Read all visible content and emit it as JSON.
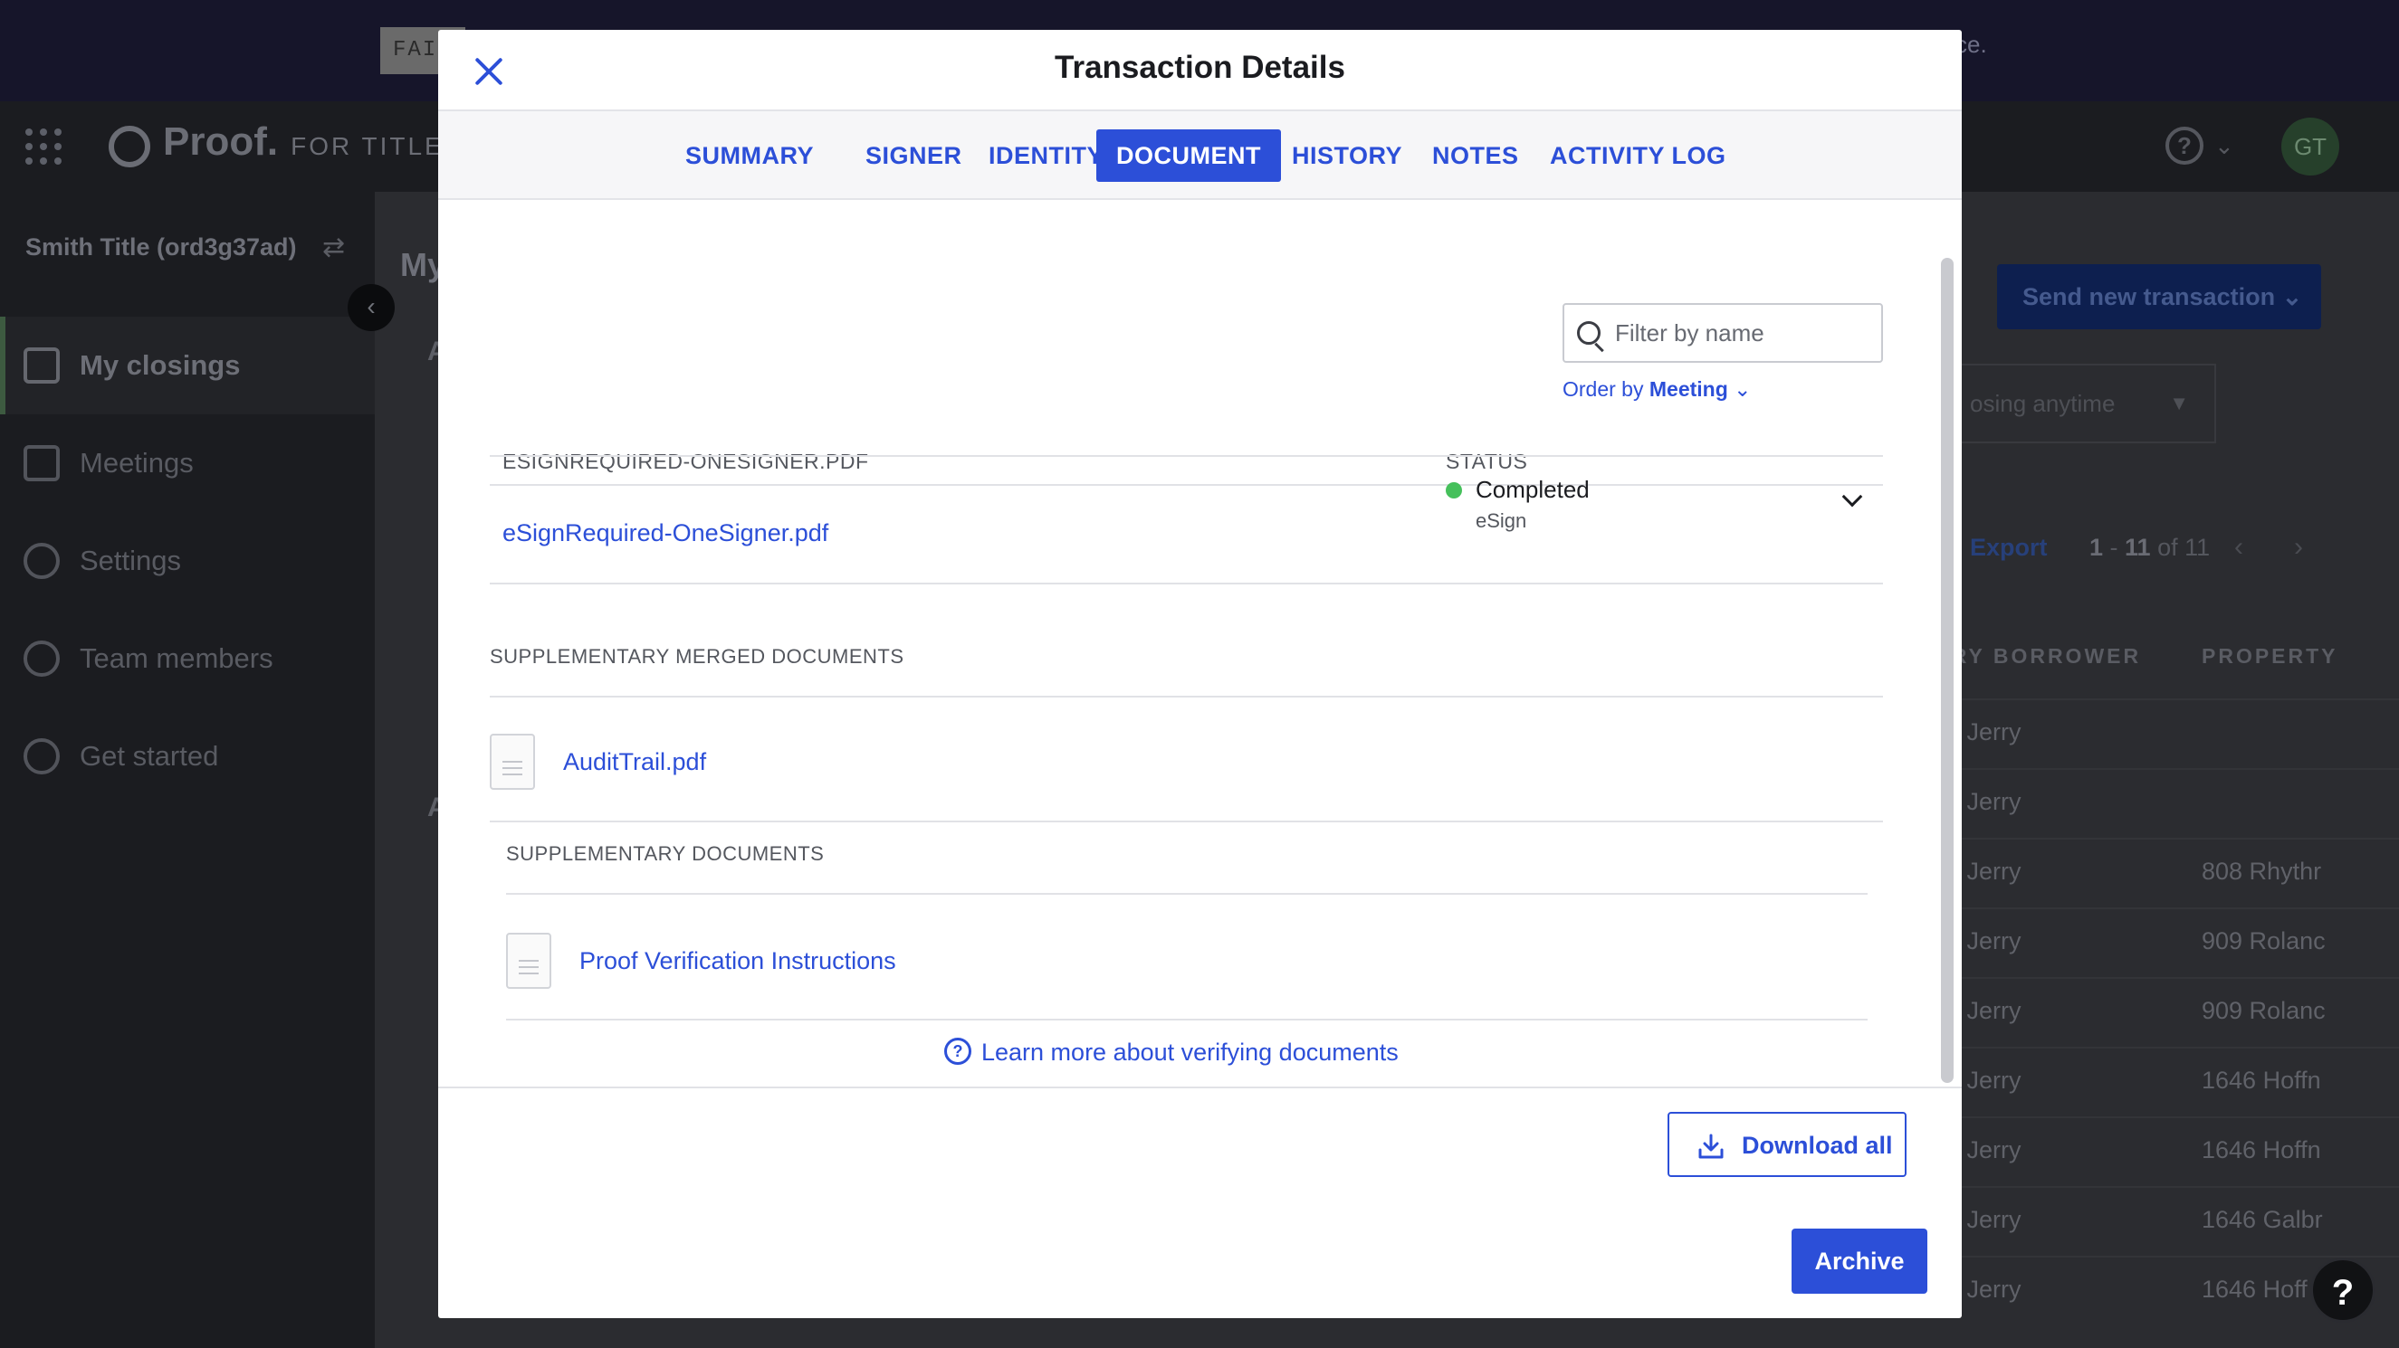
{
  "banner": {
    "tag": "FAIL",
    "tail": "ce."
  },
  "topnav": {
    "logo_word": "Proof.",
    "logo_sub": "FOR TITLE",
    "avatar_initials": "GT"
  },
  "sidebar": {
    "org": "Smith Title (ord3g37ad)",
    "items": [
      {
        "label": "My closings",
        "icon": "grid-icon",
        "active": true
      },
      {
        "label": "Meetings",
        "icon": "calendar-icon"
      },
      {
        "label": "Settings",
        "icon": "gear-icon"
      },
      {
        "label": "Team members",
        "icon": "users-icon"
      },
      {
        "label": "Get started",
        "icon": "rocket-icon"
      }
    ]
  },
  "main": {
    "title": "My",
    "letter_a": "A",
    "send_button": "Send new transaction",
    "closing_filter": "osing anytime",
    "export": "Export",
    "paging": {
      "start": "1",
      "dash": " - ",
      "end": "11",
      "of": " of 11"
    },
    "columns": [
      "MARY BORROWER",
      "PROPERTY"
    ],
    "rows": [
      {
        "borrower": "feld, Jerry",
        "property": ""
      },
      {
        "borrower": "feld, Jerry",
        "property": ""
      },
      {
        "borrower": "feld, Jerry",
        "property": "808 Rhythr"
      },
      {
        "borrower": "feld, Jerry",
        "property": "909 Rolanc"
      },
      {
        "borrower": "feld, Jerry",
        "property": "909 Rolanc"
      },
      {
        "borrower": "feld, Jerry",
        "property": "1646 Hoffn"
      },
      {
        "borrower": "feld, Jerry",
        "property": "1646 Hoffn"
      },
      {
        "borrower": "feld, Jerry",
        "property": "1646 Galbr"
      },
      {
        "borrower": "feld, Jerry",
        "property": "1646 Hoff"
      }
    ]
  },
  "modal": {
    "title": "Transaction Details",
    "tabs": [
      "SUMMARY",
      "SIGNER",
      "IDENTITY",
      "DOCUMENT",
      "HISTORY",
      "NOTES",
      "ACTIVITY LOG"
    ],
    "active_tab": "DOCUMENT",
    "filter_placeholder": "Filter by name",
    "order_by": {
      "label": "Order by",
      "value": "Meeting"
    },
    "table": {
      "name_header": "ESIGNREQUIRED-ONESIGNER.PDF",
      "status_header": "STATUS",
      "doc_name": "eSignRequired-OneSigner.pdf",
      "status": "Completed",
      "status_sub": "eSign",
      "status_color": "#45c05b"
    },
    "merged_label": "SUPPLEMENTARY MERGED DOCUMENTS",
    "merged_doc": "AuditTrail.pdf",
    "supp_label": "SUPPLEMENTARY DOCUMENTS",
    "supp_doc": "Proof Verification Instructions",
    "learn_more": "Learn more about verifying documents",
    "download_all": "Download all",
    "archive": "Archive"
  },
  "colors": {
    "accent": "#2c4fd8",
    "success": "#45c05b"
  }
}
